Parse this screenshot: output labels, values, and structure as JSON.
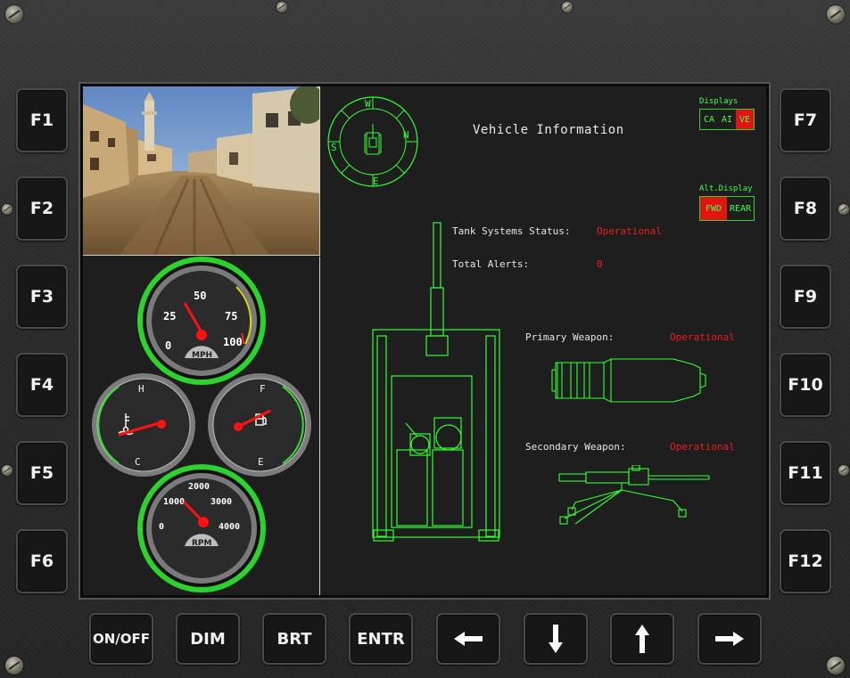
{
  "function_keys": {
    "left": [
      "F1",
      "F2",
      "F3",
      "F4",
      "F5",
      "F6"
    ],
    "right": [
      "F7",
      "F8",
      "F9",
      "F10",
      "F11",
      "F12"
    ]
  },
  "bottom_keys": {
    "on_off": "ON/OFF",
    "dim": "DIM",
    "brt": "BRT",
    "entr": "ENTR",
    "left_arrow": "left-arrow-icon",
    "down_arrow": "down-arrow-icon",
    "up_arrow": "up-arrow-icon",
    "right_arrow": "right-arrow-icon"
  },
  "compass": {
    "labels": [
      "W",
      "N",
      "E",
      "S"
    ]
  },
  "info": {
    "title": "Vehicle Information",
    "tank_status_label": "Tank Systems Status:",
    "tank_status_value": "Operational",
    "total_alerts_label": "Total Alerts:",
    "total_alerts_value": "0",
    "primary_weapon_label": "Primary Weapon:",
    "primary_weapon_value": "Operational",
    "secondary_weapon_label": "Secondary Weapon:",
    "secondary_weapon_value": "Operational"
  },
  "displays": {
    "label": "Displays",
    "options": [
      "CA",
      "AI",
      "VE"
    ],
    "selected": "VE"
  },
  "alt_display": {
    "label": "Alt.Display",
    "options": [
      "FWD",
      "REAR"
    ],
    "selected": "FWD"
  },
  "speedometer": {
    "unit": "MPH",
    "ticks": [
      "0",
      "25",
      "50",
      "75",
      "100"
    ],
    "value": 40
  },
  "tachometer": {
    "unit": "RPM",
    "ticks": [
      "0",
      "1000",
      "2000",
      "3000",
      "4000"
    ],
    "value": 1300
  },
  "temp_gauge": {
    "high": "H",
    "low": "C",
    "icon": "coolant-temperature-icon",
    "level": 0.35
  },
  "fuel_gauge": {
    "high": "F",
    "low": "E",
    "icon": "fuel-pump-icon",
    "level": 0.65
  },
  "colors": {
    "hud_green": "#33ff33",
    "alert_red": "#ee1c1c",
    "gauge_ring_green": "#2ed22e"
  }
}
